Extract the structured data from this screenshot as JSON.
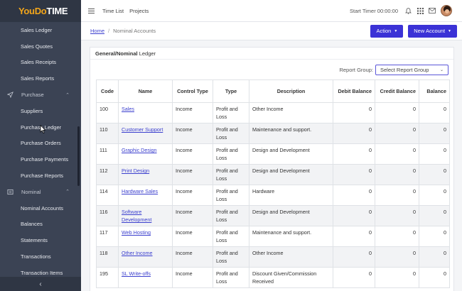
{
  "brand": {
    "part1": "YouDo",
    "part2": "TIME"
  },
  "sidebar": {
    "items": [
      {
        "label": "Sales Ledger"
      },
      {
        "label": "Sales Quotes"
      },
      {
        "label": "Sales Receipts"
      },
      {
        "label": "Sales Reports"
      }
    ],
    "purchase": {
      "label": "Purchase",
      "items": [
        {
          "label": "Suppliers"
        },
        {
          "label": "Purchase Ledger"
        },
        {
          "label": "Purchase Orders"
        },
        {
          "label": "Purchase Payments"
        },
        {
          "label": "Purchase Reports"
        }
      ]
    },
    "nominal": {
      "label": "Nominal",
      "items": [
        {
          "label": "Nominal Accounts"
        },
        {
          "label": "Balances"
        },
        {
          "label": "Statements"
        },
        {
          "label": "Transactions"
        },
        {
          "label": "Transaction Items"
        }
      ]
    }
  },
  "topbar": {
    "links": [
      "Time List",
      "Projects"
    ],
    "timer": "Start Timer 00:00:00"
  },
  "breadcrumb": {
    "home": "Home",
    "separator": "/",
    "current": "Nominal Accounts"
  },
  "buttons": {
    "action": "Action",
    "new_account": "New Account"
  },
  "card": {
    "title_bold": "General/Nominal",
    "title_rest": " Ledger"
  },
  "filter": {
    "label": "Report Group:",
    "placeholder": "Select Report Group"
  },
  "table": {
    "headers": [
      "Code",
      "Name",
      "Control Type",
      "Type",
      "Description",
      "Debit Balance",
      "Credit Balance",
      "Balance"
    ],
    "rows": [
      {
        "code": "100",
        "name": "Sales",
        "control": "Income",
        "type": "Profit and Loss",
        "desc": "Other Income",
        "debit": "0",
        "credit": "0",
        "balance": "0"
      },
      {
        "code": "110",
        "name": "Customer Support",
        "control": "Income",
        "type": "Profit and Loss",
        "desc": "Maintenance and support.",
        "debit": "0",
        "credit": "0",
        "balance": "0"
      },
      {
        "code": "111",
        "name": "Graphic Design",
        "control": "Income",
        "type": "Profit and Loss",
        "desc": "Design and Development",
        "debit": "0",
        "credit": "0",
        "balance": "0"
      },
      {
        "code": "112",
        "name": "Print Design",
        "control": "Income",
        "type": "Profit and Loss",
        "desc": "Design and Development",
        "debit": "0",
        "credit": "0",
        "balance": "0"
      },
      {
        "code": "114",
        "name": "Hardware Sales",
        "control": "Income",
        "type": "Profit and Loss",
        "desc": "Hardware",
        "debit": "0",
        "credit": "0",
        "balance": "0"
      },
      {
        "code": "116",
        "name": "Software Development",
        "control": "Income",
        "type": "Profit and Loss",
        "desc": "Design and Development",
        "debit": "0",
        "credit": "0",
        "balance": "0"
      },
      {
        "code": "117",
        "name": "Web Hosting",
        "control": "Income",
        "type": "Profit and Loss",
        "desc": "Maintenance and support.",
        "debit": "0",
        "credit": "0",
        "balance": "0"
      },
      {
        "code": "118",
        "name": "Other Income",
        "control": "Income",
        "type": "Profit and Loss",
        "desc": "Other Income",
        "debit": "0",
        "credit": "0",
        "balance": "0"
      },
      {
        "code": "195",
        "name": "SL Write-offs",
        "control": "Income",
        "type": "Profit and Loss",
        "desc": "Discount Given/Commission Received",
        "debit": "0",
        "credit": "0",
        "balance": "0"
      }
    ]
  },
  "colors": {
    "sidebar": "#3b4354",
    "accent": "#3b32d6",
    "link": "#3b3fce",
    "brand_orange": "#f2a51a"
  }
}
